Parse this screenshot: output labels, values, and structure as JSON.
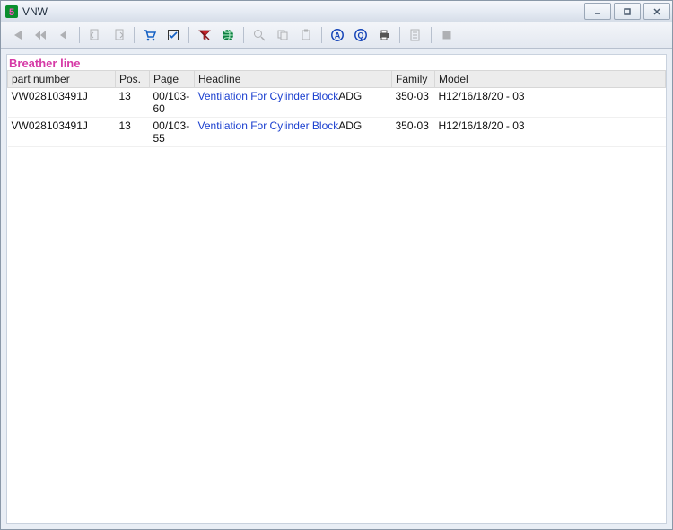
{
  "window": {
    "title": "VNW"
  },
  "section_title": "Breather line",
  "columns": {
    "part_number": "part number",
    "pos": "Pos.",
    "page": "Page",
    "headline": "Headline",
    "family": "Family",
    "model": "Model"
  },
  "rows": [
    {
      "part_number": "VW028103491J",
      "pos": "13",
      "page": "00/103-60",
      "headline": "Ventilation For Cylinder Block",
      "headline_suffix": "ADG",
      "family": "350-03",
      "model": "H12/16/18/20 - 03"
    },
    {
      "part_number": "VW028103491J",
      "pos": "13",
      "page": "00/103-55",
      "headline": "Ventilation For Cylinder Block",
      "headline_suffix": "ADG",
      "family": "350-03",
      "model": "H12/16/18/20 - 03"
    }
  ],
  "toolbar": {
    "first": "first-record-icon",
    "prev_page": "prev-page-icon",
    "prev": "prev-record-icon",
    "bookmark_prev": "bookmark-prev-icon",
    "bookmark_next": "bookmark-next-icon",
    "cart": "cart-icon",
    "checklist": "checklist-icon",
    "filter": "filter-icon",
    "globe": "globe-icon",
    "zoom": "zoom-icon",
    "copy": "copy-icon",
    "paste": "paste-icon",
    "search_a": "search-a-icon",
    "search_q": "search-q-icon",
    "print": "print-icon",
    "notes": "notes-icon",
    "stop": "stop-icon"
  }
}
